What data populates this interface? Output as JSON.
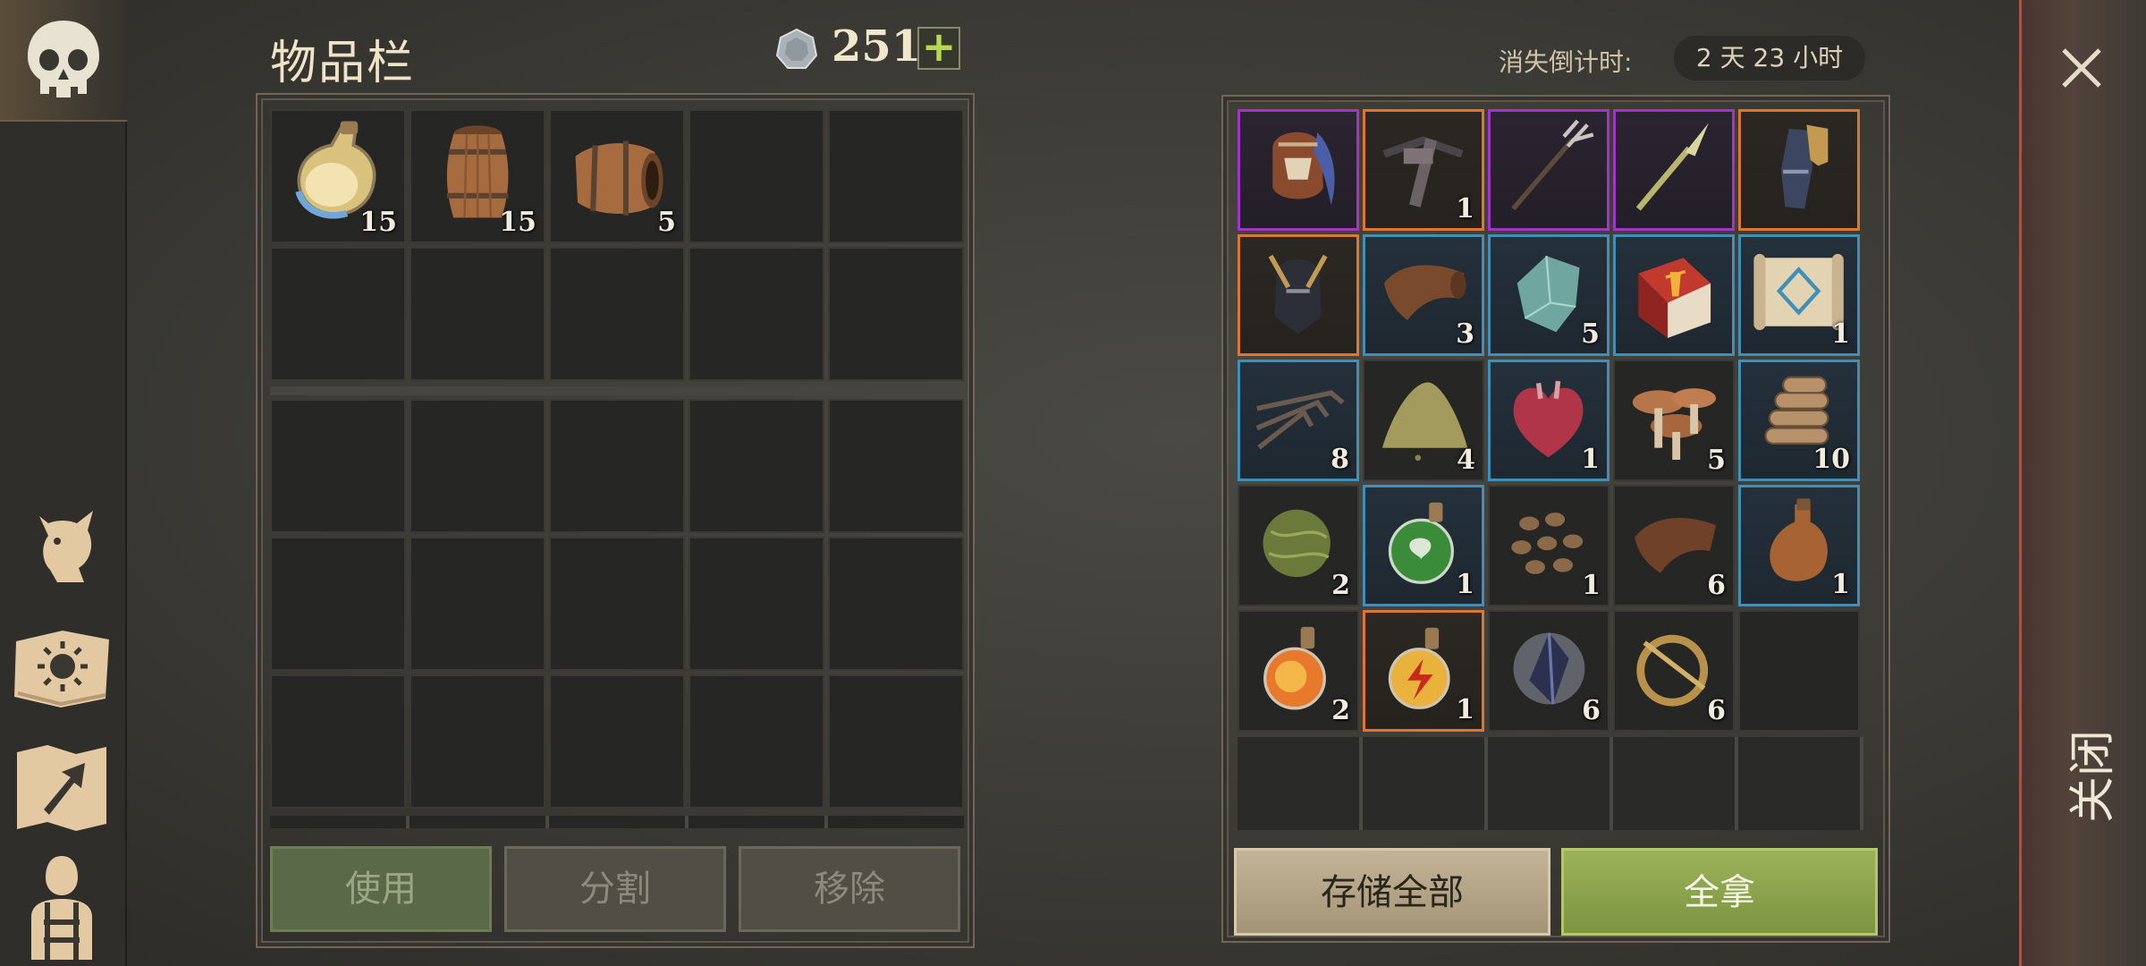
{
  "inventory": {
    "title": "物品栏",
    "currency": {
      "icon": "silver-coin-icon",
      "value": "251",
      "add_label": "+"
    },
    "top_slots": [
      {
        "icon": "potion-bottle-icon",
        "qty": "15"
      },
      {
        "icon": "upright-barrel-icon",
        "qty": "15"
      },
      {
        "icon": "lying-barrel-icon",
        "qty": "5"
      },
      {
        "icon": "",
        "qty": ""
      },
      {
        "icon": "",
        "qty": ""
      },
      {
        "icon": "",
        "qty": ""
      },
      {
        "icon": "",
        "qty": ""
      },
      {
        "icon": "",
        "qty": ""
      },
      {
        "icon": "",
        "qty": ""
      },
      {
        "icon": "",
        "qty": ""
      }
    ],
    "buttons": {
      "use": "使用",
      "split": "分割",
      "remove": "移除"
    }
  },
  "loot": {
    "countdown_label": "消失倒计时:",
    "countdown_value": "2 天 23 小时",
    "slots": [
      {
        "icon": "helmet-feathered-icon",
        "qty": "",
        "rarity": "purple"
      },
      {
        "icon": "crossbow-icon",
        "qty": "1",
        "rarity": "orange"
      },
      {
        "icon": "trident-icon",
        "qty": "",
        "rarity": "purple"
      },
      {
        "icon": "spear-icon",
        "qty": "",
        "rarity": "purple"
      },
      {
        "icon": "gauntlets-icon",
        "qty": "",
        "rarity": "orange"
      },
      {
        "icon": "knight-helmet-icon",
        "qty": "",
        "rarity": "orange"
      },
      {
        "icon": "leather-icon",
        "qty": "3",
        "rarity": "blue"
      },
      {
        "icon": "crystal-shard-icon",
        "qty": "5",
        "rarity": "blue"
      },
      {
        "icon": "red-book-icon",
        "qty": "",
        "rarity": "blue"
      },
      {
        "icon": "scroll-map-icon",
        "qty": "1",
        "rarity": "blue"
      },
      {
        "icon": "claw-icon",
        "qty": "8",
        "rarity": "blue"
      },
      {
        "icon": "sand-pile-icon",
        "qty": "4",
        "rarity": "none"
      },
      {
        "icon": "heart-icon",
        "qty": "1",
        "rarity": "blue"
      },
      {
        "icon": "mushrooms-icon",
        "qty": "5",
        "rarity": "none"
      },
      {
        "icon": "firewood-icon",
        "qty": "10",
        "rarity": "blue"
      },
      {
        "icon": "herb-ball-icon",
        "qty": "2",
        "rarity": "none"
      },
      {
        "icon": "green-potion-icon",
        "qty": "1",
        "rarity": "blue"
      },
      {
        "icon": "beans-icon",
        "qty": "1",
        "rarity": "none"
      },
      {
        "icon": "leather-scrap-icon",
        "qty": "6",
        "rarity": "none"
      },
      {
        "icon": "jug-icon",
        "qty": "1",
        "rarity": "blue"
      },
      {
        "icon": "fire-potion-icon",
        "qty": "2",
        "rarity": "none"
      },
      {
        "icon": "lightning-potion-icon",
        "qty": "1",
        "rarity": "orange"
      },
      {
        "icon": "dark-crystal-icon",
        "qty": "6",
        "rarity": "none"
      },
      {
        "icon": "brooch-ring-icon",
        "qty": "6",
        "rarity": "none"
      },
      {
        "icon": "",
        "qty": "",
        "rarity": "none"
      }
    ],
    "buttons": {
      "store_all": "存储全部",
      "take_all": "全拿"
    }
  },
  "close_label": "关闭",
  "colors": {
    "purple": "#a235c7",
    "orange": "#e0762c",
    "blue": "#3f8fb8",
    "take_all": "#8aa24a"
  }
}
